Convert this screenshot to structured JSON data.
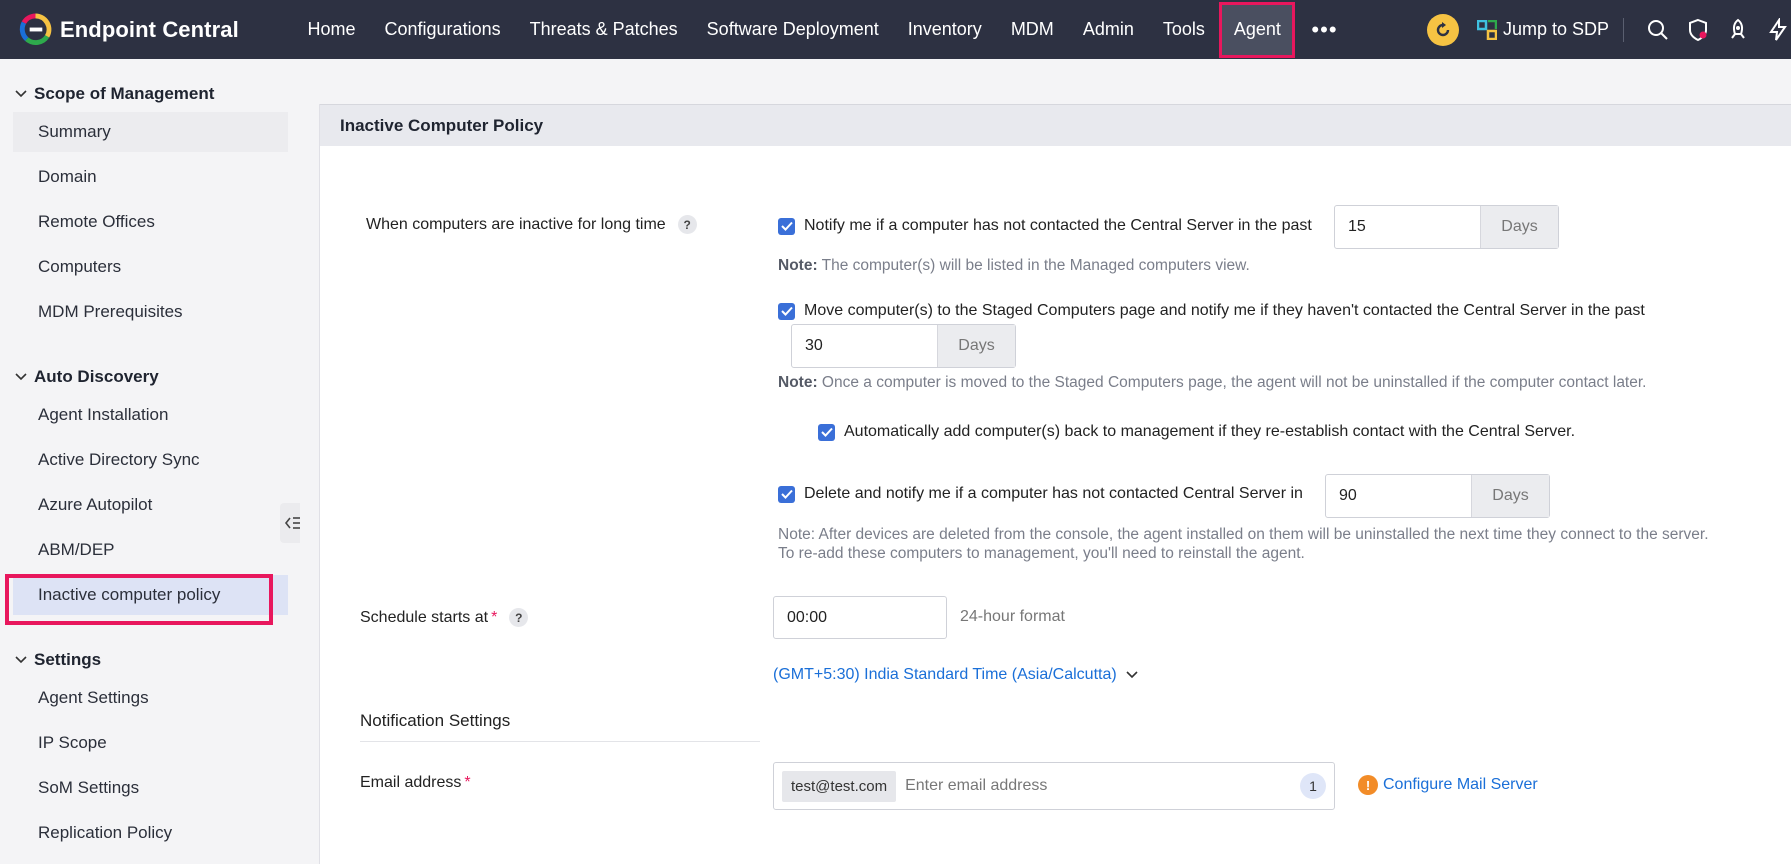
{
  "app": {
    "title": "Endpoint Central"
  },
  "nav": {
    "items": [
      "Home",
      "Configurations",
      "Threats & Patches",
      "Software Deployment",
      "Inventory",
      "MDM",
      "Admin",
      "Tools",
      "Agent"
    ],
    "active": "Agent",
    "more_label": "•••"
  },
  "topbar": {
    "jump_label": "Jump to SDP"
  },
  "sidebar": {
    "sections": [
      {
        "title": "Scope of Management",
        "items": [
          "Summary",
          "Domain",
          "Remote Offices",
          "Computers",
          "MDM Prerequisites"
        ]
      },
      {
        "title": "Auto Discovery",
        "items": [
          "Agent Installation",
          "Active Directory Sync",
          "Azure Autopilot",
          "ABM/DEP",
          "Inactive computer policy"
        ]
      },
      {
        "title": "Settings",
        "items": [
          "Agent Settings",
          "IP Scope",
          "SoM Settings",
          "Replication Policy"
        ]
      }
    ],
    "selected": "Inactive computer policy"
  },
  "policy": {
    "title": "Inactive Computer Policy",
    "inactive_label": "When computers are inactive for long time",
    "help": "?",
    "notify": {
      "label": "Notify me if a computer has not contacted the Central Server in the past",
      "checked": true,
      "value": "15",
      "unit": "Days"
    },
    "notify_note": {
      "prefix": "Note:",
      "text": " The computer(s) will be listed in the Managed computers view."
    },
    "move": {
      "label": "Move computer(s) to the Staged Computers page and notify me if they haven't contacted the Central Server in the past",
      "checked": true,
      "value": "30",
      "unit": "Days"
    },
    "move_note": {
      "prefix": "Note:",
      "text": " Once a computer is moved to the Staged Computers page, the agent will not be uninstalled if the computer contact later."
    },
    "auto_add": {
      "label": "Automatically add computer(s) back to management if they re-establish contact with the Central Server.",
      "checked": true
    },
    "delete": {
      "label": "Delete and notify me if a computer has not contacted Central Server in",
      "checked": true,
      "value": "90",
      "unit": "Days"
    },
    "delete_note_1": "Note: After devices are deleted from the console, the agent installed on them will be uninstalled the next time they connect to the server.",
    "delete_note_2": "To re-add these computers to management, you'll need to reinstall the agent.",
    "schedule_label": "Schedule starts at",
    "required_mark": "*",
    "schedule_value": "00:00",
    "schedule_format": "24-hour format",
    "timezone": "(GMT+5:30) India Standard Time (Asia/Calcutta)",
    "notification_heading": "Notification Settings",
    "email_label": "Email address",
    "email_chip": "test@test.com",
    "email_placeholder": "Enter email address",
    "email_count": "1",
    "warn_icon": "!",
    "configure_mail": "Configure Mail Server"
  },
  "colors": {
    "topbar": "#2d3142",
    "accent": "#e8175d",
    "link": "#1a6fd8",
    "checkbox": "#3a6fd8"
  }
}
